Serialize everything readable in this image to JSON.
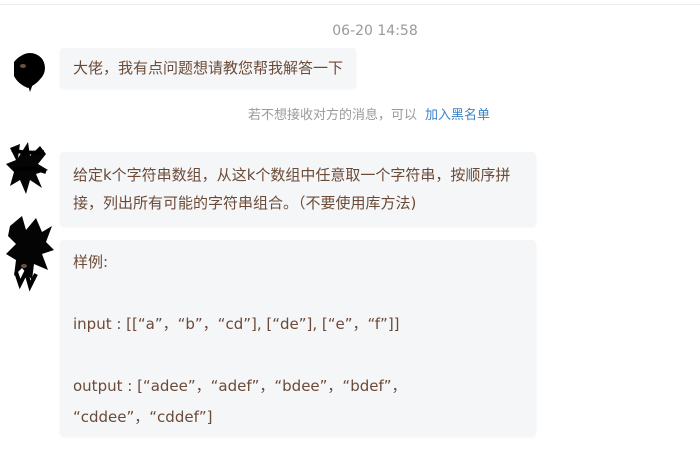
{
  "chat": {
    "timestamp": "06-20 14:58",
    "messages": [
      {
        "text": "大佬，我有点问题想请教您帮我解答一下"
      },
      {
        "text": "给定k个字符串数组，从这k个数组中任意取一个字符串，按顺序拼接，列出所有可能的字符串组合。（不要使用库方法)"
      },
      {
        "lines": [
          "样例:",
          "input : [[“a”，“b”，“cd”], [“de”], [“e”，“f”]]",
          "output : [“adee”，“adef”，“bdee”，“bdef”，",
          "“cddee”，“cddef”]"
        ]
      }
    ],
    "notice": {
      "text": "若不想接收对方的消息，可以",
      "link": "加入黑名单"
    }
  },
  "colors": {
    "message_text": "#6b4a38",
    "bubble_bg": "#f5f6f7",
    "link": "#3b83c9",
    "muted": "#9a9a9a"
  },
  "icons": {
    "avatar": "scribbled-avatar-icon"
  }
}
